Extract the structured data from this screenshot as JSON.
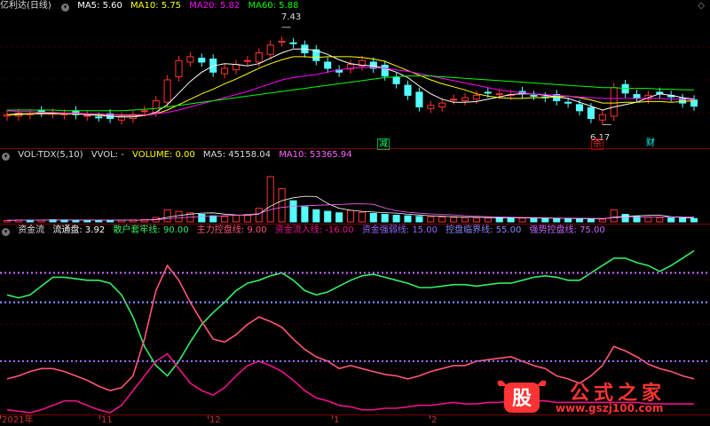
{
  "colors": {
    "up": "#ff3232",
    "down": "#54ffff",
    "ma5": "#ffffff",
    "ma10": "#ffff00",
    "ma20": "#ff00ff",
    "ma60": "#00ff00",
    "green": "#33ee66",
    "pink": "#ff5577",
    "magenta": "#ee1188",
    "hl1": "#9966ff",
    "hl2": "#8888ff",
    "hl3": "#cc66ff",
    "grid": "#7a0000"
  },
  "title_bar": {
    "stock": "亿利达(日线)",
    "ma5_label": "MA5: 5.60",
    "ma10_label": "MA10: 5.75",
    "ma20_label": "MA20: 5.82",
    "ma60_label": "MA60: 5.88",
    "high_label": "7.43",
    "low_label": "6.17"
  },
  "signals": {
    "s1": "减",
    "s2": "杀",
    "s3": "财"
  },
  "vol_bar": {
    "name": "VOL-TDX(5,10)",
    "vvol": "VVOL: -",
    "volume": "VOLUME: 0.00",
    "ma5": "MA5: 45158.04",
    "ma10": "MA10: 53365.94"
  },
  "flow_bar": {
    "name": "资金流",
    "circ": "流通盘: 3.92",
    "l1": "散户套牢线: 90.00",
    "l2": "主力控盘线: 9.00",
    "l3": "资金流入线: -16.00",
    "l4": "资金强弱线: 15.00",
    "l5": "控盘临界线: 55.00",
    "l6": "强势控盘线: 75.00"
  },
  "x_labels": [
    "2021年",
    "11",
    "12",
    "1",
    "2"
  ],
  "watermark": {
    "brand": "公式之家",
    "url": "www.gszj100.com",
    "seal": "股"
  },
  "chart_data": [
    {
      "type": "candlestick",
      "title": "亿利达(日线)",
      "ylim": [
        5.9,
        7.6
      ],
      "high_marker": 7.43,
      "low_marker": 6.17,
      "series": [
        {
          "name": "close",
          "values": [
            6.3,
            6.32,
            6.31,
            6.33,
            6.32,
            6.31,
            6.3,
            6.29,
            6.27,
            6.25,
            6.27,
            6.3,
            6.35,
            6.48,
            6.75,
            7.0,
            7.05,
            6.98,
            6.85,
            6.9,
            6.95,
            7.0,
            7.1,
            7.2,
            7.25,
            7.22,
            7.1,
            7.0,
            6.9,
            6.85,
            6.95,
            7.0,
            6.9,
            6.8,
            6.7,
            6.55,
            6.4,
            6.42,
            6.45,
            6.5,
            6.52,
            6.55,
            6.58,
            6.57,
            6.56,
            6.57,
            6.55,
            6.52,
            6.48,
            6.45,
            6.35,
            6.25,
            6.3,
            6.65,
            6.58,
            6.52,
            6.55,
            6.57,
            6.53,
            6.45,
            6.41
          ]
        },
        {
          "name": "MA5",
          "values": [
            6.3,
            6.31,
            6.31,
            6.32,
            6.32,
            6.32,
            6.31,
            6.3,
            6.29,
            6.28,
            6.27,
            6.27,
            6.29,
            6.33,
            6.43,
            6.58,
            6.73,
            6.85,
            6.93,
            6.96,
            6.95,
            6.93,
            6.96,
            7.03,
            7.1,
            7.15,
            7.15,
            7.13,
            7.08,
            7.01,
            6.96,
            6.94,
            6.93,
            6.9,
            6.85,
            6.78,
            6.67,
            6.57,
            6.5,
            6.46,
            6.46,
            6.47,
            6.5,
            6.53,
            6.56,
            6.57,
            6.57,
            6.55,
            6.53,
            6.51,
            6.46,
            6.41,
            6.36,
            6.4,
            6.43,
            6.46,
            6.52,
            6.57,
            6.55,
            6.52,
            6.5
          ]
        },
        {
          "name": "MA10",
          "values": [
            6.3,
            6.3,
            6.31,
            6.31,
            6.31,
            6.31,
            6.31,
            6.31,
            6.3,
            6.3,
            6.29,
            6.29,
            6.29,
            6.31,
            6.36,
            6.43,
            6.5,
            6.57,
            6.63,
            6.7,
            6.76,
            6.83,
            6.9,
            6.96,
            7.01,
            7.05,
            7.05,
            7.04,
            7.05,
            7.05,
            7.05,
            7.04,
            7.02,
            6.99,
            6.93,
            6.87,
            6.81,
            6.75,
            6.7,
            6.66,
            6.62,
            6.57,
            6.54,
            6.52,
            6.51,
            6.51,
            6.52,
            6.52,
            6.53,
            6.54,
            6.52,
            6.49,
            6.45,
            6.45,
            6.46,
            6.46,
            6.47,
            6.47,
            6.46,
            6.47,
            6.48
          ]
        },
        {
          "name": "MA20",
          "values": [
            6.35,
            6.34,
            6.34,
            6.33,
            6.33,
            6.32,
            6.32,
            6.31,
            6.31,
            6.3,
            6.3,
            6.3,
            6.3,
            6.31,
            6.33,
            6.36,
            6.4,
            6.44,
            6.48,
            6.52,
            6.56,
            6.6,
            6.65,
            6.7,
            6.75,
            6.78,
            6.8,
            6.82,
            6.85,
            6.88,
            6.9,
            6.91,
            6.91,
            6.9,
            6.88,
            6.86,
            6.83,
            6.8,
            6.77,
            6.74,
            6.71,
            6.68,
            6.65,
            6.62,
            6.6,
            6.58,
            6.57,
            6.56,
            6.55,
            6.54,
            6.53,
            6.52,
            6.51,
            6.51,
            6.51,
            6.51,
            6.51,
            6.51,
            6.5,
            6.5,
            6.49
          ]
        },
        {
          "name": "MA60",
          "values": [
            6.36,
            6.36,
            6.36,
            6.36,
            6.36,
            6.35,
            6.35,
            6.35,
            6.35,
            6.35,
            6.35,
            6.36,
            6.37,
            6.38,
            6.4,
            6.42,
            6.44,
            6.46,
            6.48,
            6.5,
            6.52,
            6.54,
            6.56,
            6.58,
            6.6,
            6.62,
            6.64,
            6.66,
            6.68,
            6.7,
            6.72,
            6.74,
            6.76,
            6.78,
            6.79,
            6.8,
            6.8,
            6.8,
            6.79,
            6.78,
            6.77,
            6.76,
            6.75,
            6.74,
            6.73,
            6.72,
            6.71,
            6.7,
            6.69,
            6.68,
            6.67,
            6.66,
            6.65,
            6.65,
            6.64,
            6.64,
            6.64,
            6.63,
            6.63,
            6.62,
            6.62
          ]
        }
      ]
    },
    {
      "type": "bar",
      "title": "VOL-TDX(5,10)",
      "ylim": [
        0,
        200000
      ],
      "values": [
        5000,
        6000,
        5500,
        6000,
        7000,
        6500,
        6000,
        5500,
        5000,
        5500,
        6000,
        6500,
        8000,
        15000,
        40000,
        35000,
        30000,
        25000,
        20000,
        18000,
        22000,
        25000,
        45000,
        150000,
        110000,
        70000,
        50000,
        40000,
        35000,
        30000,
        38000,
        32000,
        28000,
        25000,
        22000,
        20000,
        18000,
        17000,
        16000,
        15000,
        14000,
        13000,
        13500,
        14000,
        13000,
        12500,
        12000,
        11500,
        11000,
        10500,
        10000,
        9500,
        9000,
        40000,
        25000,
        18000,
        15000,
        14000,
        13000,
        12000,
        11000
      ]
    },
    {
      "type": "line",
      "title": "资金流",
      "ylim": [
        -20,
        100
      ],
      "series": [
        {
          "name": "散户套牢线",
          "values": [
            60,
            58,
            60,
            66,
            72,
            72,
            71,
            70,
            70,
            68,
            60,
            45,
            25,
            12,
            5,
            15,
            28,
            40,
            48,
            55,
            63,
            68,
            70,
            73,
            75,
            70,
            63,
            60,
            62,
            66,
            70,
            73,
            74,
            72,
            70,
            68,
            65,
            65,
            66,
            67,
            67,
            66,
            67,
            68,
            68,
            70,
            72,
            73,
            72,
            70,
            70,
            75,
            80,
            85,
            85,
            82,
            80,
            76,
            80,
            85,
            90
          ]
        },
        {
          "name": "主力控盘线",
          "values": [
            3,
            5,
            8,
            10,
            10,
            8,
            5,
            2,
            -2,
            -5,
            -3,
            5,
            30,
            63,
            80,
            70,
            55,
            42,
            30,
            28,
            33,
            40,
            45,
            42,
            38,
            30,
            23,
            18,
            15,
            10,
            12,
            10,
            8,
            6,
            5,
            3,
            5,
            8,
            10,
            12,
            12,
            15,
            16,
            17,
            18,
            15,
            12,
            10,
            5,
            3,
            0,
            5,
            12,
            25,
            22,
            18,
            13,
            10,
            8,
            5,
            3
          ]
        },
        {
          "name": "资金流入线",
          "values": [
            -18,
            -19,
            -20,
            -18,
            -15,
            -12,
            -12,
            -15,
            -18,
            -20,
            -15,
            -5,
            5,
            15,
            20,
            10,
            0,
            -5,
            -8,
            -3,
            5,
            12,
            15,
            12,
            8,
            2,
            -5,
            -10,
            -12,
            -15,
            -16,
            -18,
            -18,
            -17,
            -17,
            -16,
            -15,
            -15,
            -14,
            -13,
            -14,
            -14,
            -13,
            -13,
            -12,
            -12,
            -12,
            -12,
            -13,
            -13,
            -13,
            -13,
            -13,
            -13,
            -13,
            -13,
            -14,
            -14,
            -14,
            -14,
            -14
          ]
        },
        {
          "name": "资金强弱线",
          "values": [
            15,
            15,
            15,
            15,
            15,
            15,
            15,
            15,
            15,
            15,
            15,
            15,
            15,
            15,
            15,
            15,
            15,
            15,
            15,
            15,
            15,
            15,
            15,
            15,
            15,
            15,
            15,
            15,
            15,
            15,
            15,
            15,
            15,
            15,
            15,
            15,
            15,
            15,
            15,
            15,
            15,
            15,
            15,
            15,
            15,
            15,
            15,
            15,
            15,
            15,
            15,
            15,
            15,
            15,
            15,
            15,
            15,
            15,
            15,
            15,
            15
          ]
        },
        {
          "name": "控盘临界线",
          "values": [
            55,
            55,
            55,
            55,
            55,
            55,
            55,
            55,
            55,
            55,
            55,
            55,
            55,
            55,
            55,
            55,
            55,
            55,
            55,
            55,
            55,
            55,
            55,
            55,
            55,
            55,
            55,
            55,
            55,
            55,
            55,
            55,
            55,
            55,
            55,
            55,
            55,
            55,
            55,
            55,
            55,
            55,
            55,
            55,
            55,
            55,
            55,
            55,
            55,
            55,
            55,
            55,
            55,
            55,
            55,
            55,
            55,
            55,
            55,
            55,
            55
          ]
        },
        {
          "name": "强势控盘线",
          "values": [
            75,
            75,
            75,
            75,
            75,
            75,
            75,
            75,
            75,
            75,
            75,
            75,
            75,
            75,
            75,
            75,
            75,
            75,
            75,
            75,
            75,
            75,
            75,
            75,
            75,
            75,
            75,
            75,
            75,
            75,
            75,
            75,
            75,
            75,
            75,
            75,
            75,
            75,
            75,
            75,
            75,
            75,
            75,
            75,
            75,
            75,
            75,
            75,
            75,
            75,
            75,
            75,
            75,
            75,
            75,
            75,
            75,
            75,
            75,
            75,
            75
          ]
        }
      ]
    }
  ]
}
